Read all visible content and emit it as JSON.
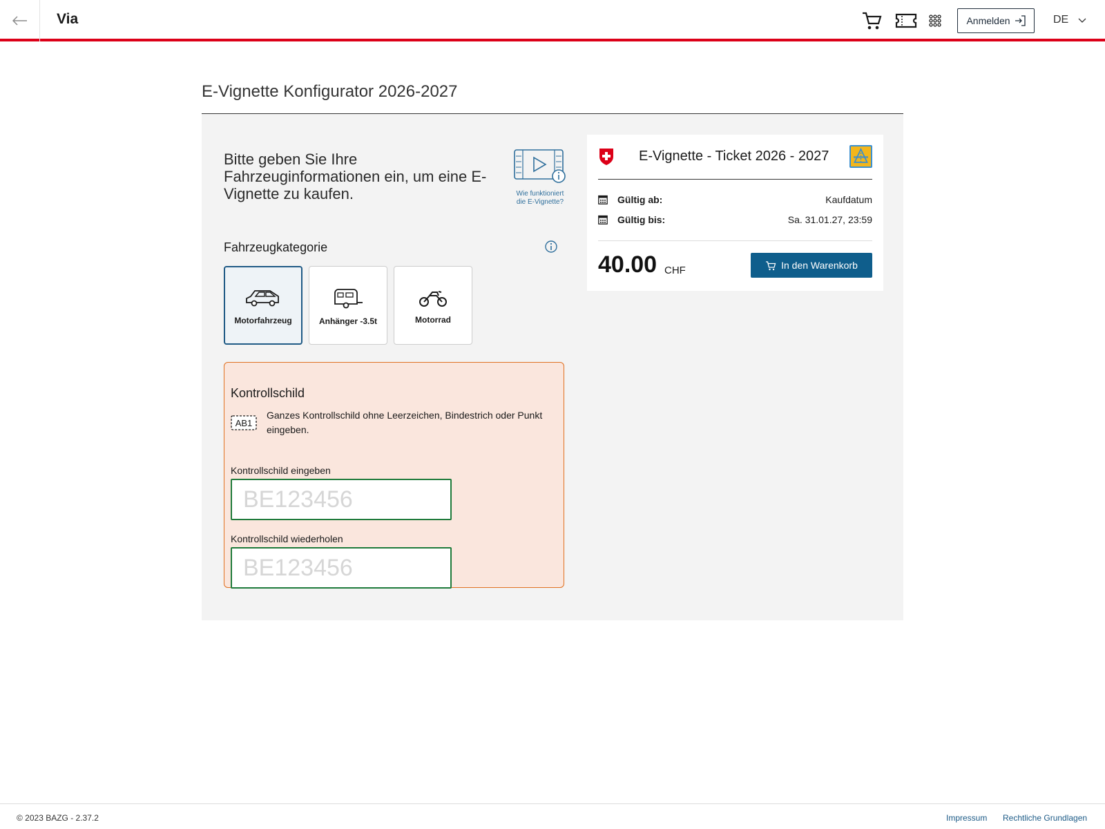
{
  "header": {
    "brand": "Via",
    "login_label": "Anmelden",
    "language": "DE",
    "icons": [
      "back-arrow-icon",
      "cart-icon",
      "ticket-icon",
      "apps-grid-icon",
      "login-icon",
      "chevron-down-icon"
    ]
  },
  "page": {
    "title": "E-Vignette Konfigurator 2026-2027"
  },
  "intro": {
    "text": "Bitte geben Sie Ihre Fahrzeuginformationen ein, um eine E-Vignette zu kaufen.",
    "howto_label_line1": "Wie funktioniert",
    "howto_label_line2": "die E-Vignette?"
  },
  "category": {
    "label": "Fahrzeugkategorie",
    "items": [
      {
        "label": "Motorfahrzeug",
        "selected": true,
        "icon": "car-icon"
      },
      {
        "label": "Anhänger -3.5t",
        "selected": false,
        "icon": "trailer-icon"
      },
      {
        "label": "Motorrad",
        "selected": false,
        "icon": "motorcycle-icon"
      }
    ]
  },
  "plate": {
    "title": "Kontrollschild",
    "icon_text": "AB1",
    "hint": "Ganzes Kontrollschild ohne Leerzeichen, Bindestrich oder Punkt eingeben.",
    "field1_label": "Kontrollschild eingeben",
    "field1_placeholder": "BE123456",
    "field1_value": "",
    "field2_label": "Kontrollschild wiederholen",
    "field2_placeholder": "BE123456",
    "field2_value": ""
  },
  "ticket": {
    "title": "E-Vignette - Ticket 2026 - 2027",
    "valid_from_label": "Gültig ab:",
    "valid_from_value": "Kaufdatum",
    "valid_to_label": "Gültig bis:",
    "valid_to_value": "Sa. 31.01.27, 23:59",
    "price": "40.00",
    "currency": "CHF",
    "cart_button": "In den Warenkorb"
  },
  "footer": {
    "copyright": "© 2023 BAZG - 2.37.2",
    "link_impressum": "Impressum",
    "link_legal": "Rechtliche Grundlagen"
  },
  "colors": {
    "accent_red": "#dc0018",
    "primary_blue": "#0f5e8c",
    "selected_border": "#1f5a85",
    "plate_box_bg": "#fae6dd",
    "plate_box_border": "#e0701f",
    "input_border": "#1e7a3a"
  }
}
